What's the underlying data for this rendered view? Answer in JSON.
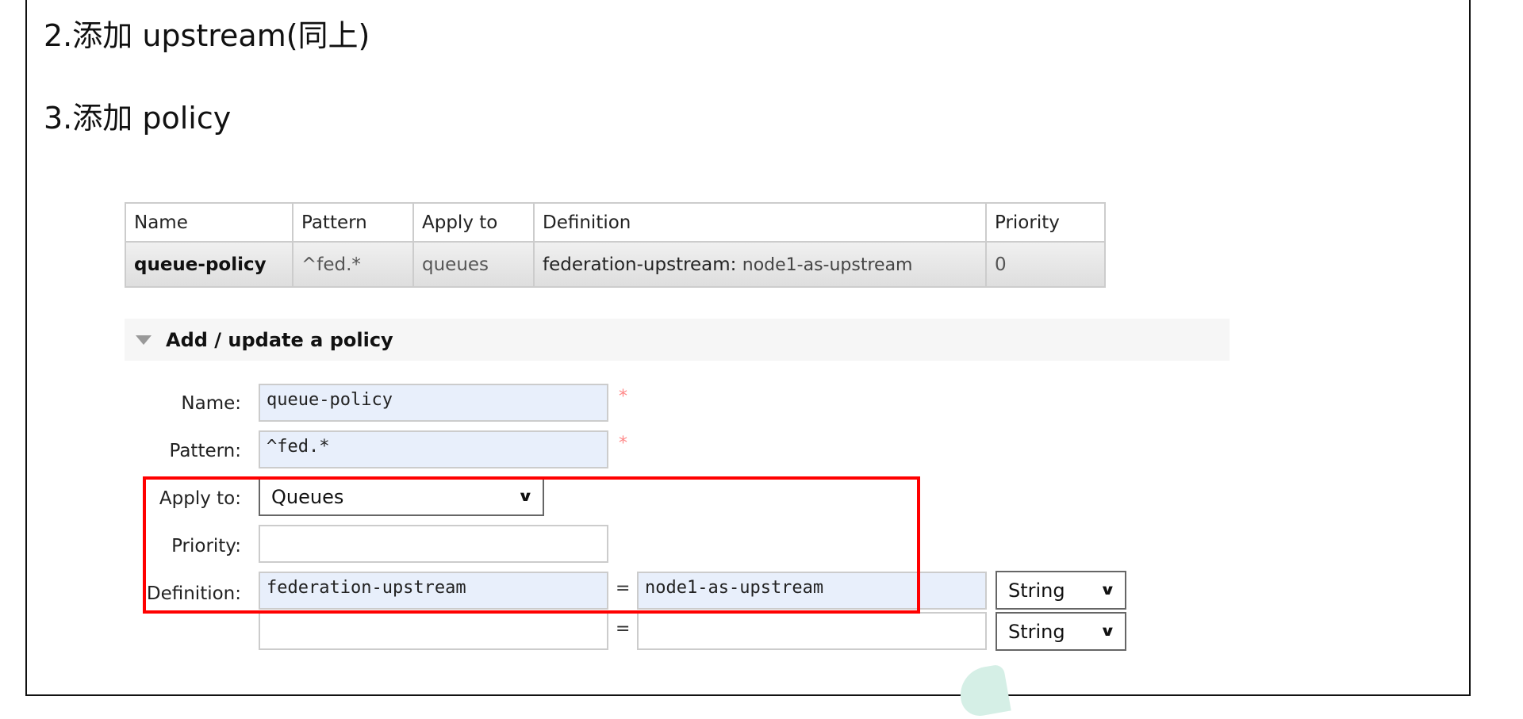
{
  "headings": {
    "step2": "2.添加 upstream(同上)",
    "step3": "3.添加 policy"
  },
  "policy_table": {
    "columns": [
      "Name",
      "Pattern",
      "Apply to",
      "Definition",
      "Priority"
    ],
    "rows": [
      {
        "name": "queue-policy",
        "pattern": "^fed.*",
        "apply_to": "queues",
        "definition_key": "federation-upstream:",
        "definition_value": "node1-as-upstream",
        "priority": "0"
      }
    ]
  },
  "form": {
    "section_title": "Add / update a policy",
    "name_label": "Name:",
    "name_value": "queue-policy",
    "pattern_label": "Pattern:",
    "pattern_value": "^fed.*",
    "required_mark": "*",
    "apply_label": "Apply to:",
    "apply_value": "Queues",
    "priority_label": "Priority:",
    "priority_value": "",
    "definition_label": "Definition:",
    "definitions": [
      {
        "key": "federation-upstream",
        "value": "node1-as-upstream",
        "type": "String"
      },
      {
        "key": "",
        "value": "",
        "type": "String"
      }
    ],
    "equals": "="
  },
  "colors": {
    "highlight": "#ff0000",
    "input_fill": "#e8effb"
  }
}
